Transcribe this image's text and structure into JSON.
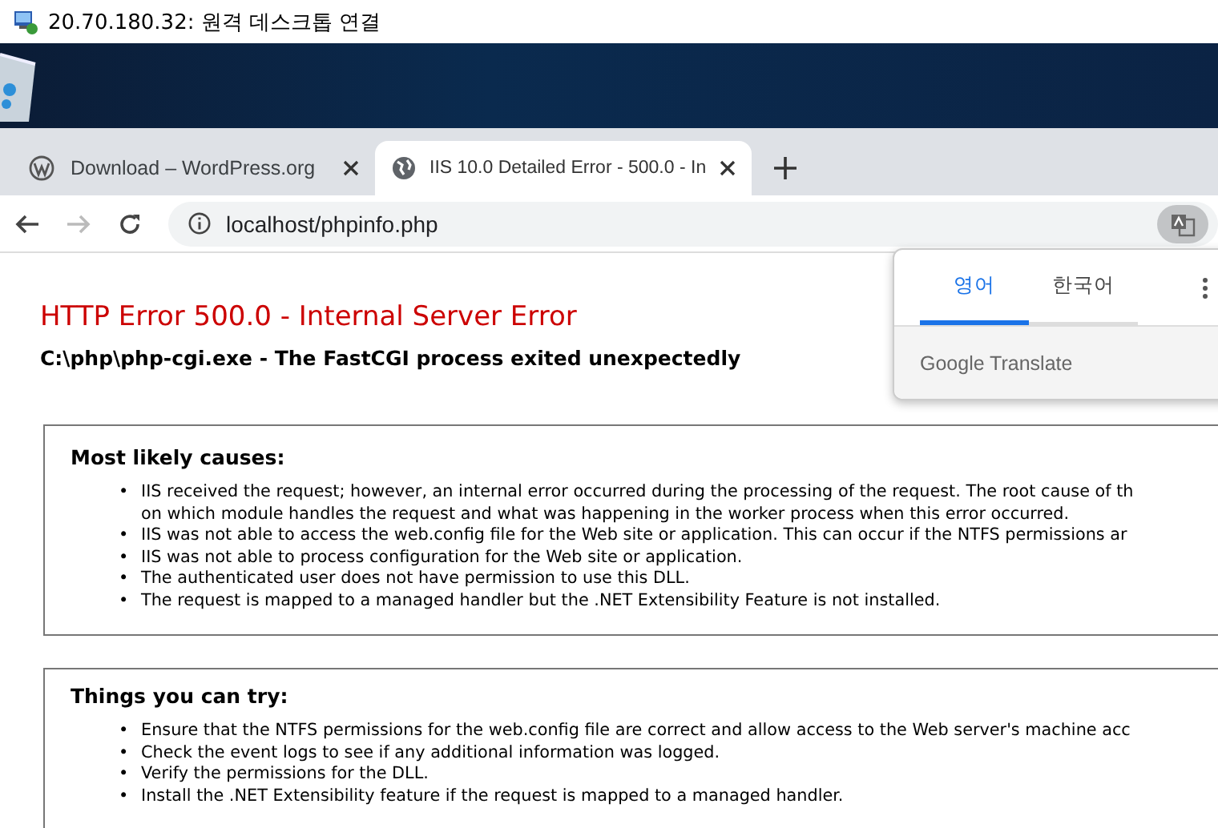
{
  "window": {
    "title": "20.70.180.32: 원격 데스크톱 연결"
  },
  "tabs": [
    {
      "title": "Download – WordPress.org",
      "selected": false
    },
    {
      "title": "IIS 10.0 Detailed Error - 500.0 - In",
      "selected": true
    }
  ],
  "address_bar": {
    "url": "localhost/phpinfo.php"
  },
  "translate_popup": {
    "languages": [
      {
        "label": "영어",
        "selected": true
      },
      {
        "label": "한국어",
        "selected": false
      }
    ],
    "footer": "Google Translate"
  },
  "page": {
    "heading": "HTTP Error 500.0 - Internal Server Error",
    "subheading": "C:\\php\\php-cgi.exe - The FastCGI process exited unexpectedly",
    "sections": [
      {
        "title": "Most likely causes:",
        "bullet": "•",
        "items": [
          "IIS received the request; however, an internal error occurred during the processing of the request. The root cause of th\non which module handles the request and what was happening in the worker process when this error occurred.",
          "IIS was not able to access the web.config file for the Web site or application. This can occur if the NTFS permissions ar",
          "IIS was not able to process configuration for the Web site or application.",
          "The authenticated user does not have permission to use this DLL.",
          "The request is mapped to a managed handler but the .NET Extensibility Feature is not installed."
        ]
      },
      {
        "title": "Things you can try:",
        "bullet": "•",
        "items": [
          "Ensure that the NTFS permissions for the web.config file are correct and allow access to the Web server's machine acc",
          "Check the event logs to see if any additional information was logged.",
          "Verify the permissions for the DLL.",
          "Install the .NET Extensibility feature if the request is mapped to a managed handler."
        ]
      }
    ]
  }
}
